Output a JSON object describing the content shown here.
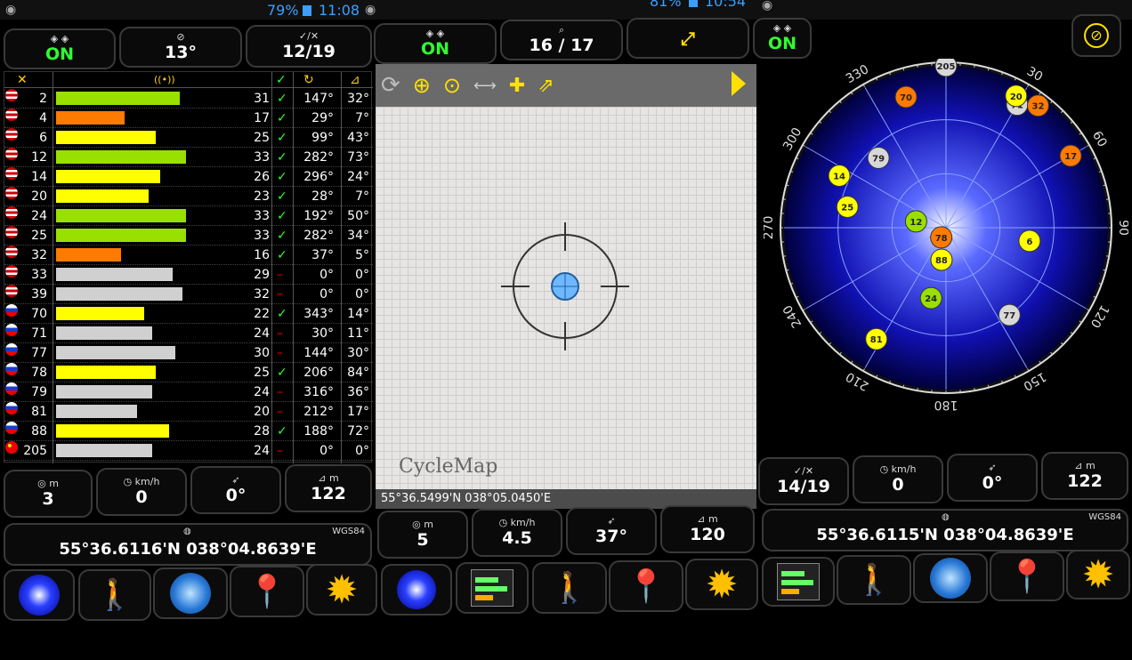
{
  "statusbars": [
    {
      "battery": "79%",
      "time": "11:08"
    },
    {
      "battery": "81%",
      "time": "10:54"
    }
  ],
  "left": {
    "tiles": [
      {
        "icon": "◈ ◈",
        "value": "ON",
        "green": true
      },
      {
        "icon": "⊘",
        "value": "13°"
      },
      {
        "icon": "✓/✕",
        "value": "12/19"
      }
    ],
    "table_header": [
      "✕",
      "((•))",
      "✓",
      "↻",
      "⊿"
    ],
    "sats": [
      {
        "prn": "2",
        "flag": "us",
        "snr": "31",
        "used": true,
        "az": "147°",
        "el": "32°",
        "sig": 0.95,
        "color": "#99e000"
      },
      {
        "prn": "4",
        "flag": "us",
        "snr": "17",
        "used": true,
        "az": "29°",
        "el": "7°",
        "sig": 0.53,
        "color": "#ff7a00"
      },
      {
        "prn": "6",
        "flag": "us",
        "snr": "25",
        "used": true,
        "az": "99°",
        "el": "43°",
        "sig": 0.77,
        "color": "#ffff00"
      },
      {
        "prn": "12",
        "flag": "us",
        "snr": "33",
        "used": true,
        "az": "282°",
        "el": "73°",
        "sig": 1.0,
        "color": "#99e000"
      },
      {
        "prn": "14",
        "flag": "us",
        "snr": "26",
        "used": true,
        "az": "296°",
        "el": "24°",
        "sig": 0.8,
        "color": "#ffff00"
      },
      {
        "prn": "20",
        "flag": "us",
        "snr": "23",
        "used": true,
        "az": "28°",
        "el": "7°",
        "sig": 0.71,
        "color": "#ffff00"
      },
      {
        "prn": "24",
        "flag": "us",
        "snr": "33",
        "used": true,
        "az": "192°",
        "el": "50°",
        "sig": 1.0,
        "color": "#99e000"
      },
      {
        "prn": "25",
        "flag": "us",
        "snr": "33",
        "used": true,
        "az": "282°",
        "el": "34°",
        "sig": 1.0,
        "color": "#99e000"
      },
      {
        "prn": "32",
        "flag": "us",
        "snr": "16",
        "used": true,
        "az": "37°",
        "el": "5°",
        "sig": 0.5,
        "color": "#ff7a00"
      },
      {
        "prn": "33",
        "flag": "us",
        "snr": "29",
        "used": false,
        "az": "0°",
        "el": "0°",
        "sig": 0.9,
        "color": "#d0d0d0"
      },
      {
        "prn": "39",
        "flag": "us",
        "snr": "32",
        "used": false,
        "az": "0°",
        "el": "0°",
        "sig": 0.97,
        "color": "#d0d0d0"
      },
      {
        "prn": "70",
        "flag": "ru",
        "snr": "22",
        "used": true,
        "az": "343°",
        "el": "14°",
        "sig": 0.68,
        "color": "#ffff00"
      },
      {
        "prn": "71",
        "flag": "ru",
        "snr": "24",
        "used": false,
        "az": "30°",
        "el": "11°",
        "sig": 0.74,
        "color": "#d0d0d0"
      },
      {
        "prn": "77",
        "flag": "ru",
        "snr": "30",
        "used": false,
        "az": "144°",
        "el": "30°",
        "sig": 0.92,
        "color": "#d0d0d0"
      },
      {
        "prn": "78",
        "flag": "ru",
        "snr": "25",
        "used": true,
        "az": "206°",
        "el": "84°",
        "sig": 0.77,
        "color": "#ffff00"
      },
      {
        "prn": "79",
        "flag": "ru",
        "snr": "24",
        "used": false,
        "az": "316°",
        "el": "36°",
        "sig": 0.74,
        "color": "#d0d0d0"
      },
      {
        "prn": "81",
        "flag": "ru",
        "snr": "20",
        "used": false,
        "az": "212°",
        "el": "17°",
        "sig": 0.62,
        "color": "#d0d0d0"
      },
      {
        "prn": "88",
        "flag": "ru",
        "snr": "28",
        "used": true,
        "az": "188°",
        "el": "72°",
        "sig": 0.87,
        "color": "#ffff00"
      },
      {
        "prn": "205",
        "flag": "cn",
        "snr": "24",
        "used": false,
        "az": "0°",
        "el": "0°",
        "sig": 0.74,
        "color": "#d0d0d0"
      }
    ],
    "stats": [
      {
        "icon": "◎ m",
        "value": "3"
      },
      {
        "icon": "◷ km/h",
        "value": "0"
      },
      {
        "icon": "➶",
        "value": "0°"
      },
      {
        "icon": "⊿ m",
        "value": "122"
      }
    ],
    "datum": "WGS84",
    "coords": "55°36.6116'N  038°04.8639'E"
  },
  "mid": {
    "tiles": [
      {
        "icon": "◈ ◈",
        "value": "ON",
        "green": true
      },
      {
        "icon": "⌕",
        "value": "16 / 17"
      },
      {
        "icon": "",
        "value": ""
      }
    ],
    "map_label": "CycleMap",
    "map_coords": "55°36.5499'N  038°05.0450'E",
    "stats": [
      {
        "icon": "◎ m",
        "value": "5"
      },
      {
        "icon": "◷ km/h",
        "value": "4.5"
      },
      {
        "icon": "➶",
        "value": "37°"
      },
      {
        "icon": "⊿ m",
        "value": "120"
      }
    ]
  },
  "right": {
    "tiles": [
      {
        "icon": "◈ ◈",
        "value": "ON",
        "green": true
      }
    ],
    "compass_labels": [
      "30",
      "60",
      "90",
      "120",
      "150",
      "180",
      "210",
      "240",
      "270",
      "300",
      "330"
    ],
    "sky_sats": [
      {
        "prn": "205",
        "az": 0,
        "el": 0,
        "color": "#d8d8d8"
      },
      {
        "prn": "71",
        "az": 30,
        "el": 11,
        "color": "#d8d8d8"
      },
      {
        "prn": "32",
        "az": 37,
        "el": 5,
        "color": "#ff7a00"
      },
      {
        "prn": "20",
        "az": 28,
        "el": 7,
        "color": "#ffff00"
      },
      {
        "prn": "17",
        "az": 60,
        "el": 10,
        "color": "#ff7a00"
      },
      {
        "prn": "70",
        "az": 343,
        "el": 14,
        "color": "#ff7a00"
      },
      {
        "prn": "79",
        "az": 316,
        "el": 36,
        "color": "#d8d8d8"
      },
      {
        "prn": "14",
        "az": 296,
        "el": 24,
        "color": "#ffff00"
      },
      {
        "prn": "25",
        "az": 282,
        "el": 34,
        "color": "#ffff00"
      },
      {
        "prn": "12",
        "az": 282,
        "el": 73,
        "color": "#99e000"
      },
      {
        "prn": "78",
        "az": 206,
        "el": 84,
        "color": "#ff7a00"
      },
      {
        "prn": "6",
        "az": 99,
        "el": 43,
        "color": "#ffff00"
      },
      {
        "prn": "88",
        "az": 188,
        "el": 72,
        "color": "#ffff00"
      },
      {
        "prn": "24",
        "az": 192,
        "el": 50,
        "color": "#99e000"
      },
      {
        "prn": "77",
        "az": 144,
        "el": 30,
        "color": "#d8d8d8"
      },
      {
        "prn": "81",
        "az": 212,
        "el": 17,
        "color": "#ffff00"
      }
    ],
    "stats": [
      {
        "icon": "✓/✕",
        "value": "14/19"
      },
      {
        "icon": "◷ km/h",
        "value": "0"
      },
      {
        "icon": "➶",
        "value": "0°"
      },
      {
        "icon": "⊿ m",
        "value": "122"
      }
    ],
    "datum": "WGS84",
    "coords": "55°36.6115'N  038°04.8639'E"
  }
}
